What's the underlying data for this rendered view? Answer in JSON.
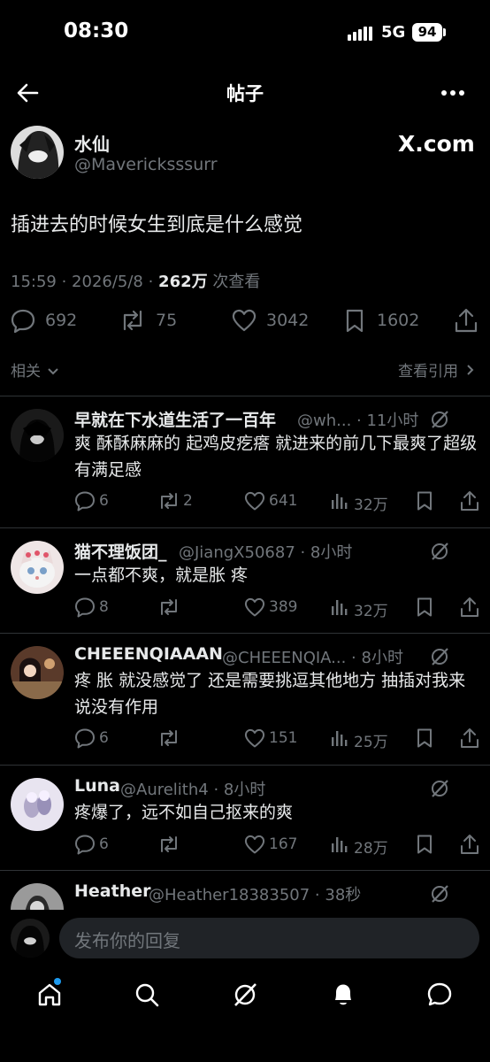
{
  "status": {
    "time": "08:30",
    "network": "5G",
    "battery": "94"
  },
  "nav": {
    "title": "帖子"
  },
  "post": {
    "author_name": "水仙",
    "author_handle": "@Mavericksssurr",
    "brand": "X.com",
    "text": "插进去的时候女生到底是什么感觉",
    "meta_prefix": "15:59 · 2026/5/8 · ",
    "views": "262万",
    "views_suffix": " 次查看",
    "replies": "692",
    "reposts": "75",
    "likes": "3042",
    "bookmarks": "1602"
  },
  "related": {
    "label": "相关",
    "quotes_label": "查看引用"
  },
  "replies": [
    {
      "name": "早就在下水道生活了一百年",
      "meta": "@wh... · 11小时",
      "text": "爽 酥酥麻麻的 起鸡皮疙瘩 就进来的前几下最爽了超级有满足感",
      "replies": "6",
      "reposts": "2",
      "likes": "641",
      "views": "32万"
    },
    {
      "name": "猫不理饭团_",
      "meta": "@JiangX50687 · 8小时",
      "text": "一点都不爽，就是胀 疼",
      "replies": "8",
      "reposts": "",
      "likes": "389",
      "views": "32万"
    },
    {
      "name": "CHEEENQIAAAN",
      "meta": "@CHEEENQIA... · 8小时",
      "text": "疼 胀 就没感觉了 还是需要挑逗其他地方 抽插对我来说没有作用",
      "replies": "6",
      "reposts": "",
      "likes": "151",
      "views": "25万"
    },
    {
      "name": "Luna",
      "meta": "@Aurelith4 · 8小时",
      "text": "疼爆了，远不如自己抠来的爽",
      "replies": "6",
      "reposts": "",
      "likes": "167",
      "views": "28万"
    },
    {
      "name": "Heather",
      "meta": "@Heather18383507 · 38秒",
      "text": "",
      "replies": "",
      "reposts": "",
      "likes": "",
      "views": ""
    }
  ],
  "composer": {
    "placeholder": "发布你的回复"
  },
  "icons": {
    "back": "arrow-left-icon",
    "more": "more-dots-icon",
    "reply": "reply-bubble-icon",
    "repost": "repost-icon",
    "like": "heart-icon",
    "bookmark": "bookmark-icon",
    "share": "share-icon",
    "views": "views-bars-icon",
    "grok": "grok-icon",
    "home": "home-icon",
    "search": "search-icon",
    "bell": "bell-icon",
    "messages": "messages-icon"
  },
  "colors": {
    "background": "#000000",
    "text": "#e7e9ea",
    "muted": "#71767b",
    "accent": "#1d9bf0"
  }
}
